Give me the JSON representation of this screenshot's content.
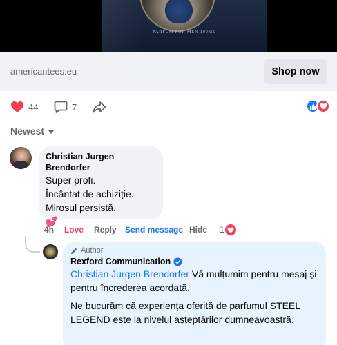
{
  "post": {
    "media": {
      "bottle_text": "PARFUM FOR MEN 100ML"
    },
    "link": {
      "domain": "americantees.eu",
      "cta_label": "Shop now"
    },
    "stats": {
      "love_count": "44",
      "comment_count": "7"
    }
  },
  "comments": {
    "sort_label": "Newest",
    "items": [
      {
        "author": "Christian Jurgen Brendorfer",
        "lines": [
          "Super profi.",
          "Încântat de achiziție.",
          "Mirosul persistă."
        ],
        "emoji": "💕",
        "time": "4h",
        "reaction_label": "Love",
        "reply_label": "Reply",
        "send_label": "Send message",
        "hide_label": "Hide",
        "reaction_count": "1"
      }
    ],
    "reply": {
      "badge": "Author",
      "author": "Rexford Communication",
      "mention": "Christian Jurgen Brendorfer",
      "text1": " Vă mulțumim pentru mesaj și pentru încrederea acordată.",
      "text2": "Ne bucurăm că experiența oferită de parfumul STEEL LEGEND este la nivelul așteptărilor dumneavoastră."
    }
  },
  "colors": {
    "accent_blue": "#1877f2",
    "love_red": "#f33e58",
    "bubble_gray": "#f0f2f5",
    "author_bubble": "#e7f3ff"
  }
}
